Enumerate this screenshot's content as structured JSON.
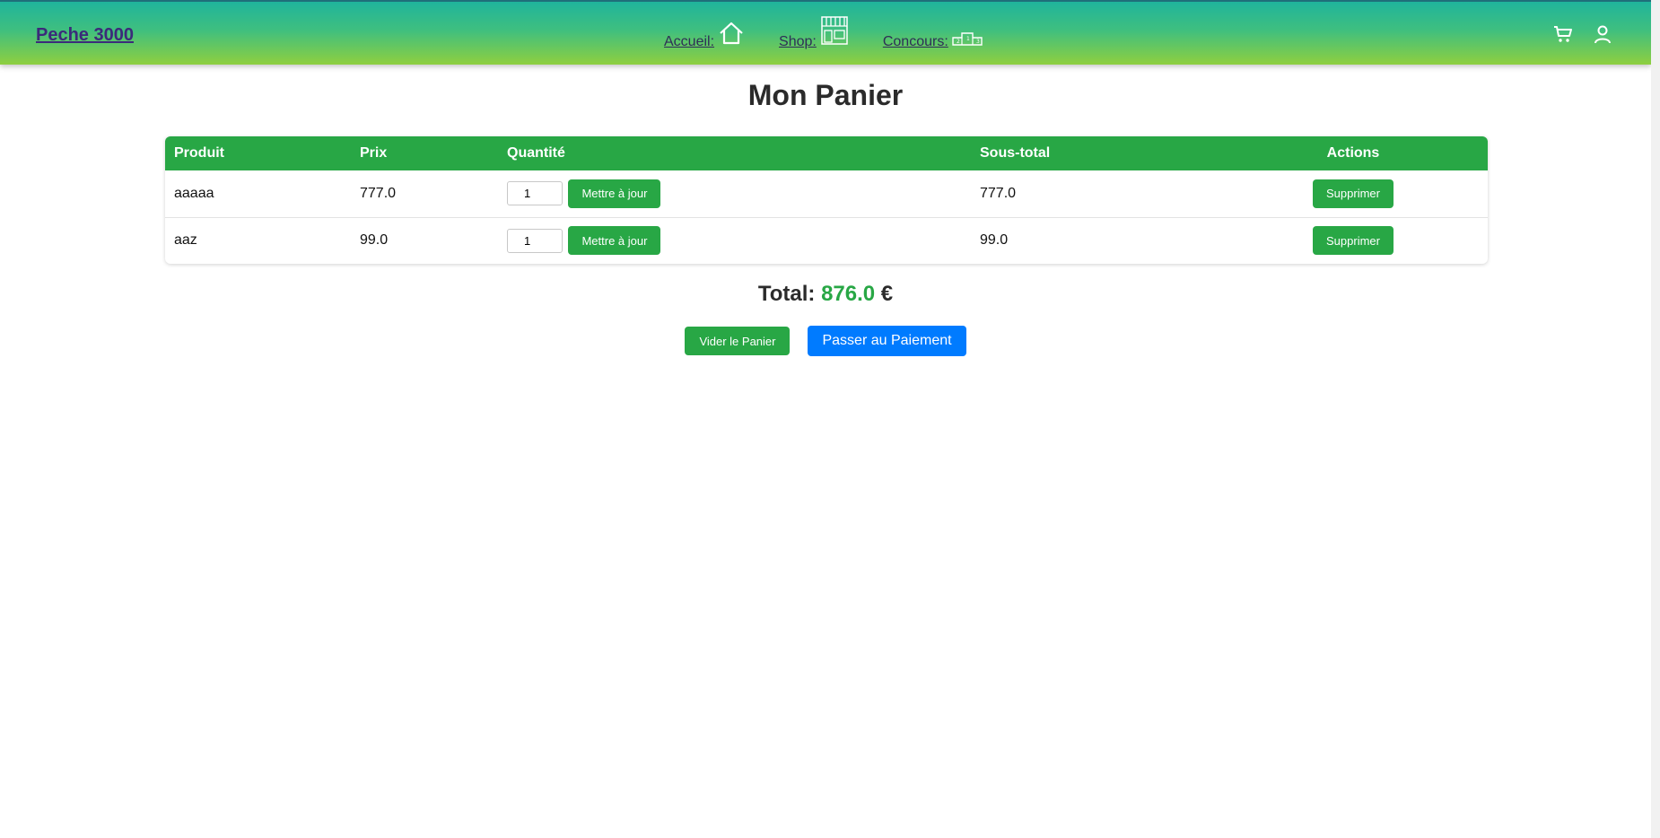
{
  "header": {
    "brand": "Peche 3000",
    "nav": [
      {
        "label": "Accueil:",
        "icon": "home-icon"
      },
      {
        "label": "Shop:",
        "icon": "shop-icon"
      },
      {
        "label": "Concours:",
        "icon": "podium-icon"
      }
    ],
    "right_icons": [
      "cart-icon",
      "user-icon"
    ]
  },
  "main": {
    "title": "Mon Panier",
    "table": {
      "headers": [
        "Produit",
        "Prix",
        "Quantité",
        "Sous-total",
        "Actions"
      ],
      "rows": [
        {
          "product": "aaaaa",
          "price": "777.0",
          "quantity": "1",
          "update_label": "Mettre à jour",
          "subtotal": "777.0",
          "delete_label": "Supprimer"
        },
        {
          "product": "aaz",
          "price": "99.0",
          "quantity": "1",
          "update_label": "Mettre à jour",
          "subtotal": "99.0",
          "delete_label": "Supprimer"
        }
      ]
    },
    "total_label": "Total:",
    "total_value": "876.0",
    "currency": "€",
    "clear_label": "Vider le Panier",
    "pay_label": "Passer au Paiement"
  },
  "colors": {
    "accent_green": "#28a745",
    "primary_blue": "#007bff"
  }
}
